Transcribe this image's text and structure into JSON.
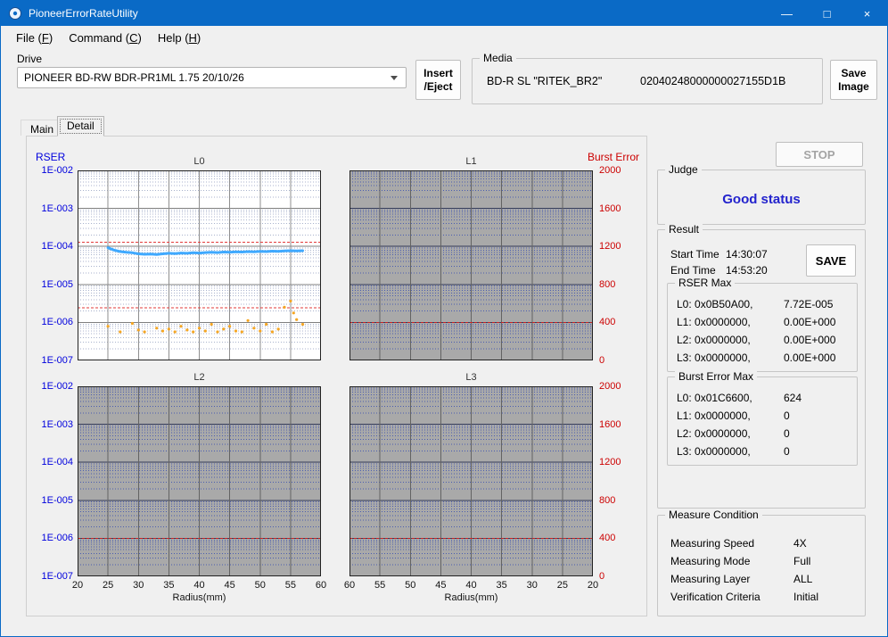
{
  "colors": {
    "accent": "#0a6ac6",
    "rser": "#0000dd",
    "burst": "#cc0000",
    "judge": "#2323cd"
  },
  "window": {
    "title": "PioneerErrorRateUtility",
    "controls": {
      "minimize": "—",
      "maximize": "□",
      "close": "×"
    }
  },
  "menu": {
    "items": [
      {
        "label": "File (F)"
      },
      {
        "label": "Command (C)"
      },
      {
        "label": "Help (H)"
      }
    ]
  },
  "toolbar": {
    "drive": {
      "label": "Drive",
      "value": "PIONEER BD-RW BDR-PR1ML 1.75 20/10/26"
    },
    "insert_eject": {
      "line1": "Insert",
      "line2": "/Eject"
    },
    "media": {
      "label": "Media",
      "disc": "BD-R SL \"RITEK_BR2\"",
      "serial": "02040248000000027155D1B"
    },
    "save_image": {
      "line1": "Save",
      "line2": "Image"
    }
  },
  "tabs": [
    {
      "label": "Main",
      "active": false
    },
    {
      "label": "Detail",
      "active": true
    }
  ],
  "axes": {
    "rser_title": "RSER",
    "burst_title": "Burst Error",
    "rser_ticks": [
      "1E-002",
      "1E-003",
      "1E-004",
      "1E-005",
      "1E-006",
      "1E-007"
    ],
    "burst_ticks": [
      "2000",
      "1600",
      "1200",
      "800",
      "400",
      "0"
    ],
    "x_label": "Radius(mm)"
  },
  "right_panel": {
    "stop_label": "STOP",
    "judge": {
      "label": "Judge",
      "status": "Good status"
    },
    "result": {
      "label": "Result",
      "start_time_label": "Start Time",
      "start_time": "14:30:07",
      "end_time_label": "End Time",
      "end_time": "14:53:20",
      "save_label": "SAVE",
      "rser_max": {
        "label": "RSER Max",
        "rows": [
          {
            "hex": "L0: 0x0B50A00,",
            "value": "7.72E-005"
          },
          {
            "hex": "L1: 0x0000000,",
            "value": "0.00E+000"
          },
          {
            "hex": "L2: 0x0000000,",
            "value": "0.00E+000"
          },
          {
            "hex": "L3: 0x0000000,",
            "value": "0.00E+000"
          }
        ]
      },
      "burst_max": {
        "label": "Burst Error Max",
        "rows": [
          {
            "hex": "L0: 0x01C6600,",
            "value": "624"
          },
          {
            "hex": "L1: 0x0000000,",
            "value": "0"
          },
          {
            "hex": "L2: 0x0000000,",
            "value": "0"
          },
          {
            "hex": "L3: 0x0000000,",
            "value": "0"
          }
        ]
      }
    },
    "measure": {
      "label": "Measure Condition",
      "rows": [
        {
          "label": "Measuring Speed",
          "value": "4X"
        },
        {
          "label": "Measuring Mode",
          "value": "Full"
        },
        {
          "label": "Measuring Layer",
          "value": "ALL"
        },
        {
          "label": "Verification Criteria",
          "value": "Initial"
        }
      ]
    }
  },
  "chart_data": [
    {
      "id": "L0",
      "title": "L0",
      "type": "line",
      "x_axis": {
        "label": "Radius(mm)",
        "range": [
          20,
          60
        ],
        "reversed": false,
        "tick_step": 5
      },
      "y_axis": {
        "label": "RSER",
        "scale": "log",
        "range": [
          1e-07,
          0.01
        ]
      },
      "y2_axis": {
        "label": "Burst Error",
        "range": [
          0,
          2000
        ]
      },
      "show_x_labels": false,
      "thresholds_rser": [
        0.00013,
        2.4e-06
      ],
      "colors": {
        "bg": "#ffffff",
        "minor": "#a8b2cc",
        "major": "#7f7f7f",
        "vert": "#8f8f8f",
        "threshold": "#e23a3a"
      },
      "rser_series": {
        "name": "RSER",
        "color": "#3fa9ff",
        "x": [
          25,
          26,
          27,
          28,
          29,
          30,
          31,
          32,
          33,
          34,
          35,
          36,
          37,
          38,
          39,
          40,
          41,
          42,
          43,
          44,
          45,
          46,
          47,
          48,
          49,
          50,
          51,
          52,
          53,
          54,
          55,
          56,
          57
        ],
        "y": [
          9.2e-05,
          8e-05,
          7.3e-05,
          7e-05,
          6.8e-05,
          6.4e-05,
          6.2e-05,
          6.3e-05,
          6.1e-05,
          6.4e-05,
          6.6e-05,
          6.5e-05,
          6.7e-05,
          6.6e-05,
          6.8e-05,
          6.7e-05,
          6.9e-05,
          7e-05,
          6.9e-05,
          7.1e-05,
          7e-05,
          7.2e-05,
          7.1e-05,
          7.3e-05,
          7.2e-05,
          7.4e-05,
          7.3e-05,
          7.5e-05,
          7.4e-05,
          7.6e-05,
          7.7e-05,
          7.6e-05,
          7.7e-05
        ]
      },
      "burst_series": {
        "name": "Burst Error",
        "color": "#f5a623",
        "x": [
          25,
          27,
          29,
          30,
          31,
          33,
          34,
          35,
          36,
          37,
          38,
          39,
          40,
          41,
          42,
          43,
          44,
          45,
          46,
          47,
          48,
          49,
          50,
          51,
          52,
          53,
          54,
          55,
          55.5,
          56,
          57
        ],
        "y": [
          360,
          300,
          390,
          320,
          300,
          340,
          310,
          330,
          300,
          360,
          320,
          300,
          340,
          310,
          380,
          300,
          330,
          360,
          310,
          300,
          420,
          340,
          310,
          380,
          300,
          330,
          560,
          624,
          500,
          430,
          380
        ]
      }
    },
    {
      "id": "L1",
      "title": "L1",
      "type": "empty",
      "x_axis": {
        "label": "Radius(mm)",
        "range": [
          20,
          60
        ],
        "reversed": true,
        "tick_step": 5
      },
      "y_axis": {
        "label": "RSER",
        "scale": "log",
        "range": [
          1e-07,
          0.01
        ]
      },
      "y2_axis": {
        "label": "Burst Error",
        "range": [
          0,
          2000
        ]
      },
      "show_x_labels": false,
      "thresholds_rser": [
        0.01,
        1e-06
      ],
      "colors": {
        "bg": "#a9a9a9",
        "minor": "#4a5db0",
        "major": "#343c5c",
        "vert": "#636363",
        "threshold": "#cc2222"
      }
    },
    {
      "id": "L2",
      "title": "L2",
      "type": "empty",
      "x_axis": {
        "label": "Radius(mm)",
        "range": [
          20,
          60
        ],
        "reversed": false,
        "tick_step": 5
      },
      "y_axis": {
        "label": "RSER",
        "scale": "log",
        "range": [
          1e-07,
          0.01
        ]
      },
      "y2_axis": {
        "label": "Burst Error",
        "range": [
          0,
          2000
        ]
      },
      "show_x_labels": true,
      "x_tick_labels": [
        "20",
        "25",
        "30",
        "35",
        "40",
        "45",
        "50",
        "55",
        "60"
      ],
      "thresholds_rser": [
        0.01,
        1e-06
      ],
      "colors": {
        "bg": "#a9a9a9",
        "minor": "#4a5db0",
        "major": "#343c5c",
        "vert": "#636363",
        "threshold": "#cc2222"
      }
    },
    {
      "id": "L3",
      "title": "L3",
      "type": "empty",
      "x_axis": {
        "label": "Radius(mm)",
        "range": [
          20,
          60
        ],
        "reversed": true,
        "tick_step": 5
      },
      "y_axis": {
        "label": "RSER",
        "scale": "log",
        "range": [
          1e-07,
          0.01
        ]
      },
      "y2_axis": {
        "label": "Burst Error",
        "range": [
          0,
          2000
        ]
      },
      "show_x_labels": true,
      "x_tick_labels": [
        "60",
        "55",
        "50",
        "45",
        "40",
        "35",
        "30",
        "25",
        "20"
      ],
      "thresholds_rser": [
        0.01,
        1e-06
      ],
      "colors": {
        "bg": "#a9a9a9",
        "minor": "#4a5db0",
        "major": "#343c5c",
        "vert": "#636363",
        "threshold": "#cc2222"
      }
    }
  ]
}
